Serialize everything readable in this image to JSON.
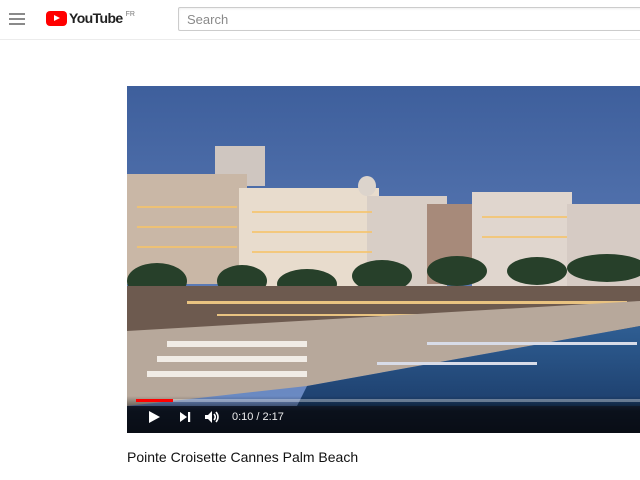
{
  "header": {
    "logo_text": "YouTube",
    "logo_country": "FR",
    "search_placeholder": "Search"
  },
  "player": {
    "current_time": "0:10",
    "time_separator": "/",
    "duration": "2:17",
    "progress_fraction": 0.073
  },
  "video": {
    "title": "Pointe Croisette Cannes Palm Beach"
  },
  "colors": {
    "brand_red": "#ff0000"
  },
  "icons": [
    "menu-icon",
    "youtube-play-icon",
    "play-icon",
    "next-icon",
    "volume-icon"
  ]
}
